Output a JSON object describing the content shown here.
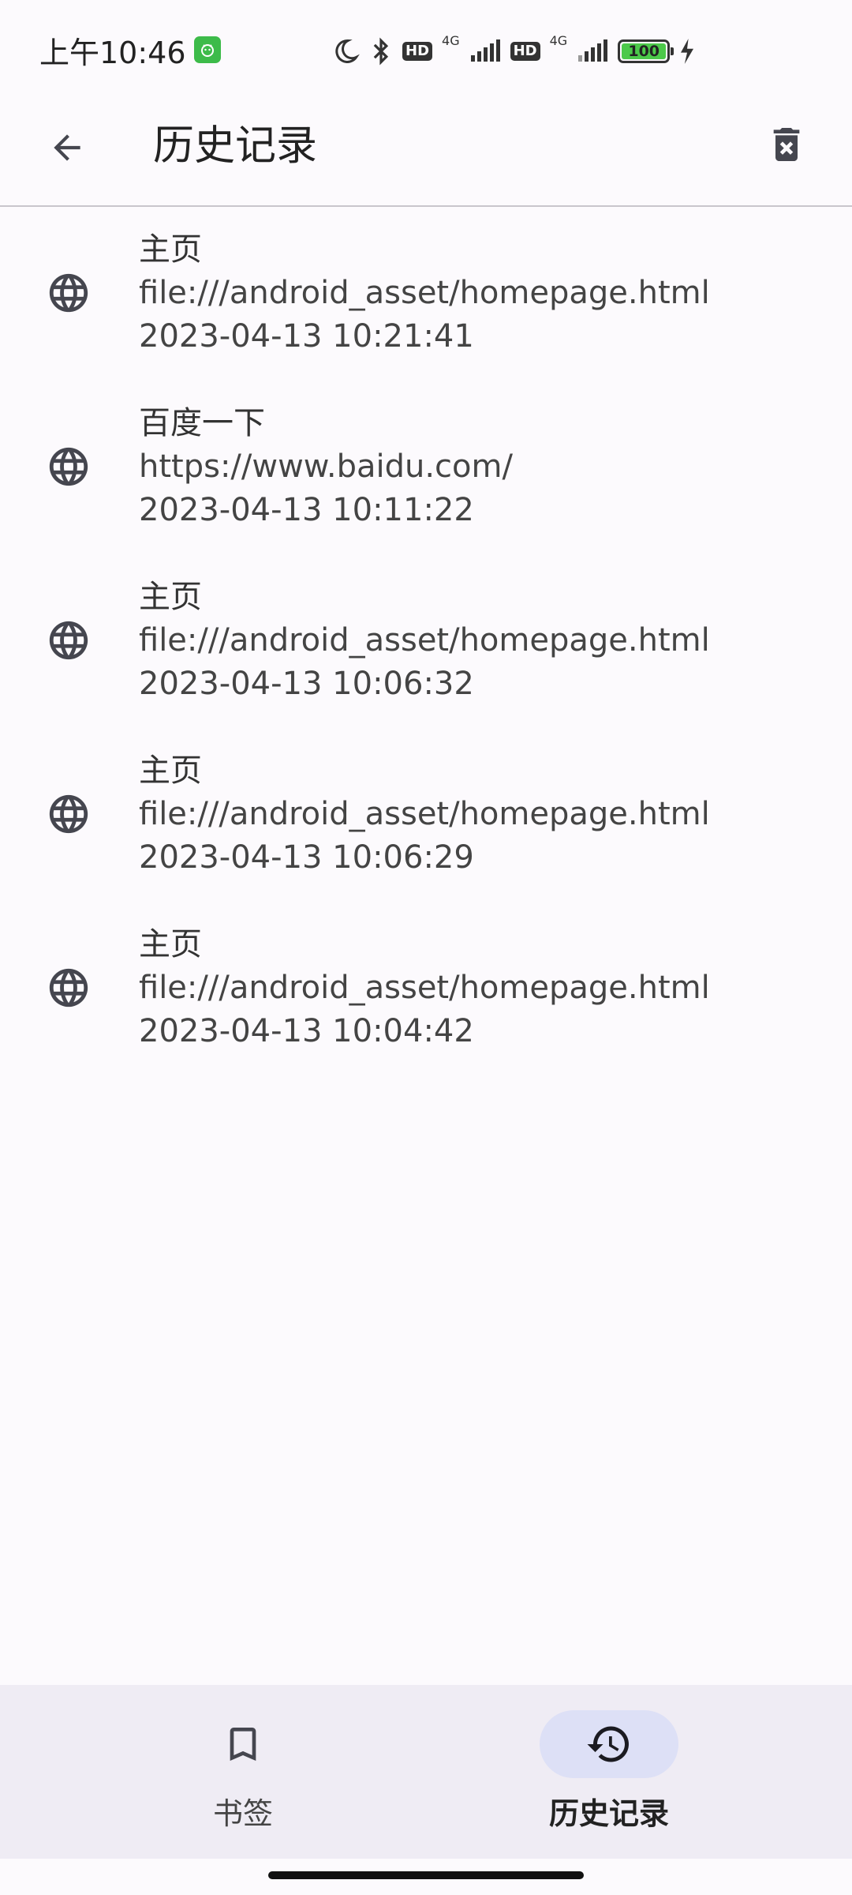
{
  "status": {
    "time": "上午10:46",
    "network1": "4G",
    "network2": "4G",
    "hd1": "HD",
    "hd2": "HD",
    "battery": "100"
  },
  "app_bar": {
    "title": "历史记录"
  },
  "history": [
    {
      "title": "主页",
      "url": "file:///android_asset/homepage.html",
      "time": "2023-04-13 10:21:41"
    },
    {
      "title": "百度一下",
      "url": "https://www.baidu.com/",
      "time": "2023-04-13 10:11:22"
    },
    {
      "title": "主页",
      "url": "file:///android_asset/homepage.html",
      "time": "2023-04-13 10:06:32"
    },
    {
      "title": "主页",
      "url": "file:///android_asset/homepage.html",
      "time": "2023-04-13 10:06:29"
    },
    {
      "title": "主页",
      "url": "file:///android_asset/homepage.html",
      "time": "2023-04-13 10:04:42"
    }
  ],
  "bottom_nav": {
    "bookmarks_label": "书签",
    "history_label": "历史记录"
  },
  "colors": {
    "background": "#fcfafd",
    "nav_background": "#efecf4",
    "nav_active_pill": "#dde0f6",
    "battery_fill": "#4cc94a"
  }
}
